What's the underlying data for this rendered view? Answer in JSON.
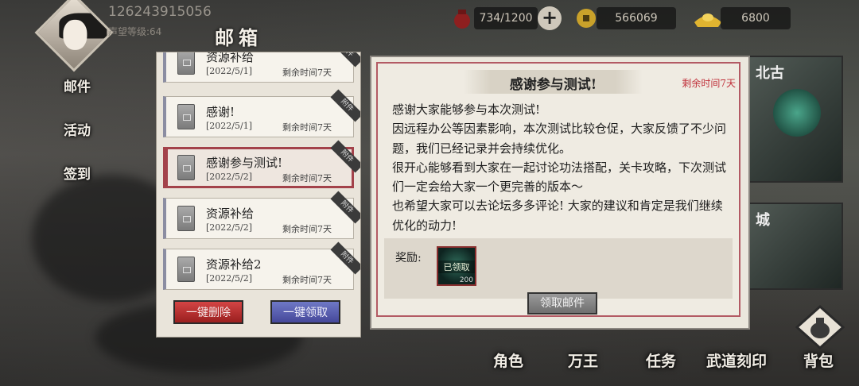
{
  "player": {
    "id": "126243915056",
    "reputation_level": "声望等级:64"
  },
  "resources": {
    "stamina": "734/1200",
    "coins": "566069",
    "ingots": "6800"
  },
  "window_title": "邮箱",
  "left_nav": [
    {
      "label": "邮件"
    },
    {
      "label": "活动"
    },
    {
      "label": "签到"
    }
  ],
  "mail_list": [
    {
      "title": "资源补给",
      "date": "[2022/5/1]",
      "remaining": "剩余时间7天",
      "tag": "附件"
    },
    {
      "title": "感谢!",
      "date": "[2022/5/1]",
      "remaining": "剩余时间7天",
      "tag": "附件"
    },
    {
      "title": "感谢参与测试!",
      "date": "[2022/5/2]",
      "remaining": "剩余时间7天",
      "tag": "附件"
    },
    {
      "title": "资源补给",
      "date": "[2022/5/2]",
      "remaining": "剩余时间7天",
      "tag": "附件"
    },
    {
      "title": "资源补给2",
      "date": "[2022/5/2]",
      "remaining": "剩余时间7天",
      "tag": "附件"
    }
  ],
  "buttons": {
    "delete_all": "一键删除",
    "claim_all": "一键领取",
    "claim_mail": "领取邮件"
  },
  "detail": {
    "title": "感谢参与测试!",
    "remaining": "剩余时间7天",
    "body": "感谢大家能够参与本次测试!\n因远程办公等因素影响，本次测试比较仓促，大家反馈了不少问题，我们已经记录并会持续优化。\n很开心能够看到大家在一起讨论功法搭配，关卡攻略，下次测试们一定会给大家一个更完善的版本～\n也希望大家可以去论坛多多评论! 大家的建议和肯定是我们继续优化的动力!",
    "reward_label": "奖励:",
    "reward_item": {
      "status": "已领取",
      "count": "200"
    }
  },
  "bottom_nav": [
    {
      "label": "角色"
    },
    {
      "label": "万王"
    },
    {
      "label": "任务"
    },
    {
      "label": "武道刻印"
    },
    {
      "label": "背包"
    }
  ],
  "side_labels": {
    "card1": "北古",
    "card2": "城"
  },
  "colors": {
    "accent_red": "#b35a64",
    "remaining_red": "#c0303a",
    "active_border": "#a3424a"
  }
}
